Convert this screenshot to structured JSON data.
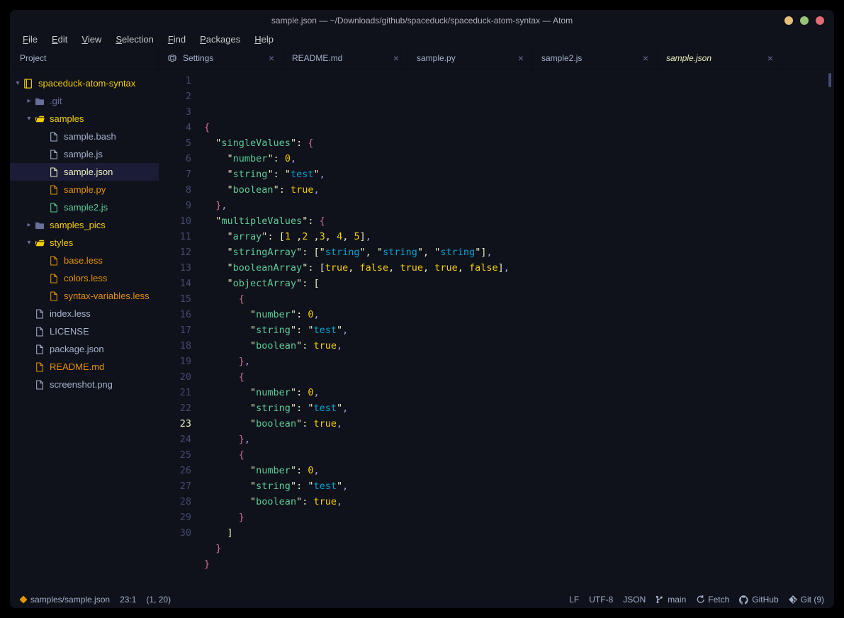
{
  "window": {
    "title": "sample.json — ~/Downloads/github/spaceduck/spaceduck-atom-syntax — Atom"
  },
  "menu": [
    "File",
    "Edit",
    "View",
    "Selection",
    "Find",
    "Packages",
    "Help"
  ],
  "projectTab": "Project",
  "tabs": [
    {
      "label": "Settings",
      "icon": "settings",
      "close": true
    },
    {
      "label": "README.md",
      "icon": "none",
      "close": true
    },
    {
      "label": "sample.py",
      "icon": "none",
      "close": true
    },
    {
      "label": "sample2.js",
      "icon": "none",
      "close": true
    },
    {
      "label": "sample.json",
      "icon": "none",
      "close": true,
      "active": true,
      "italic": true
    }
  ],
  "tree": [
    {
      "depth": 0,
      "chev": "down",
      "icon": "repo",
      "label": "spaceduck-atom-syntax",
      "color": "c-yellow"
    },
    {
      "depth": 1,
      "chev": "right",
      "icon": "folder",
      "label": ".git",
      "color": "c-grey"
    },
    {
      "depth": 1,
      "chev": "down",
      "icon": "folder-open",
      "label": "samples",
      "color": "c-yellow"
    },
    {
      "depth": 2,
      "chev": "",
      "icon": "file",
      "label": "sample.bash",
      "color": "c-muted"
    },
    {
      "depth": 2,
      "chev": "",
      "icon": "file",
      "label": "sample.js",
      "color": "c-muted"
    },
    {
      "depth": 2,
      "chev": "",
      "icon": "file",
      "label": "sample.json",
      "color": "c-white",
      "selected": true
    },
    {
      "depth": 2,
      "chev": "",
      "icon": "file",
      "label": "sample.py",
      "color": "c-orange"
    },
    {
      "depth": 2,
      "chev": "",
      "icon": "file",
      "label": "sample2.js",
      "color": "c-green"
    },
    {
      "depth": 1,
      "chev": "right",
      "icon": "folder",
      "label": "samples_pics",
      "color": "c-yellow"
    },
    {
      "depth": 1,
      "chev": "down",
      "icon": "folder-open",
      "label": "styles",
      "color": "c-yellow"
    },
    {
      "depth": 2,
      "chev": "",
      "icon": "file",
      "label": "base.less",
      "color": "c-orange"
    },
    {
      "depth": 2,
      "chev": "",
      "icon": "file",
      "label": "colors.less",
      "color": "c-orange"
    },
    {
      "depth": 2,
      "chev": "",
      "icon": "file",
      "label": "syntax-variables.less",
      "color": "c-orange"
    },
    {
      "depth": 1,
      "chev": "",
      "icon": "file",
      "label": "index.less",
      "color": "c-muted"
    },
    {
      "depth": 1,
      "chev": "",
      "icon": "file",
      "label": "LICENSE",
      "color": "c-muted"
    },
    {
      "depth": 1,
      "chev": "",
      "icon": "file",
      "label": "package.json",
      "color": "c-muted"
    },
    {
      "depth": 1,
      "chev": "",
      "icon": "file",
      "label": "README.md",
      "color": "c-orange"
    },
    {
      "depth": 1,
      "chev": "",
      "icon": "file",
      "label": "screenshot.png",
      "color": "c-muted"
    }
  ],
  "cursorLine": 23,
  "code": [
    [
      {
        "t": "{",
        "c": "brace"
      }
    ],
    [
      {
        "t": "  ",
        "c": ""
      },
      {
        "t": "\"",
        "c": "punct"
      },
      {
        "t": "singleValues",
        "c": "key"
      },
      {
        "t": "\"",
        "c": "punct"
      },
      {
        "t": ": ",
        "c": "punct"
      },
      {
        "t": "{",
        "c": "brace"
      }
    ],
    [
      {
        "t": "    ",
        "c": ""
      },
      {
        "t": "\"",
        "c": "punct"
      },
      {
        "t": "number",
        "c": "key"
      },
      {
        "t": "\"",
        "c": "punct"
      },
      {
        "t": ": ",
        "c": "punct"
      },
      {
        "t": "0",
        "c": "num"
      },
      {
        "t": ",",
        "c": "comma"
      }
    ],
    [
      {
        "t": "    ",
        "c": ""
      },
      {
        "t": "\"",
        "c": "punct"
      },
      {
        "t": "string",
        "c": "key"
      },
      {
        "t": "\"",
        "c": "punct"
      },
      {
        "t": ": ",
        "c": "punct"
      },
      {
        "t": "\"",
        "c": "punct"
      },
      {
        "t": "test",
        "c": "str"
      },
      {
        "t": "\"",
        "c": "punct"
      },
      {
        "t": ",",
        "c": "comma"
      }
    ],
    [
      {
        "t": "    ",
        "c": ""
      },
      {
        "t": "\"",
        "c": "punct"
      },
      {
        "t": "boolean",
        "c": "key"
      },
      {
        "t": "\"",
        "c": "punct"
      },
      {
        "t": ": ",
        "c": "punct"
      },
      {
        "t": "true",
        "c": "bool"
      },
      {
        "t": ",",
        "c": "comma"
      }
    ],
    [
      {
        "t": "  ",
        "c": ""
      },
      {
        "t": "}",
        "c": "brace"
      },
      {
        "t": ",",
        "c": "comma"
      }
    ],
    [
      {
        "t": "  ",
        "c": ""
      },
      {
        "t": "\"",
        "c": "punct"
      },
      {
        "t": "multipleValues",
        "c": "key"
      },
      {
        "t": "\"",
        "c": "punct"
      },
      {
        "t": ": ",
        "c": "punct"
      },
      {
        "t": "{",
        "c": "brace"
      }
    ],
    [
      {
        "t": "    ",
        "c": ""
      },
      {
        "t": "\"",
        "c": "punct"
      },
      {
        "t": "array",
        "c": "key"
      },
      {
        "t": "\"",
        "c": "punct"
      },
      {
        "t": ": ",
        "c": "punct"
      },
      {
        "t": "[",
        "c": "bracket"
      },
      {
        "t": "1",
        "c": "num"
      },
      {
        "t": " ,",
        "c": "punct"
      },
      {
        "t": "2",
        "c": "num"
      },
      {
        "t": " ,",
        "c": "punct"
      },
      {
        "t": "3",
        "c": "num"
      },
      {
        "t": ", ",
        "c": "punct"
      },
      {
        "t": "4",
        "c": "num"
      },
      {
        "t": ", ",
        "c": "punct"
      },
      {
        "t": "5",
        "c": "num"
      },
      {
        "t": "]",
        "c": "bracket"
      },
      {
        "t": ",",
        "c": "comma"
      }
    ],
    [
      {
        "t": "    ",
        "c": ""
      },
      {
        "t": "\"",
        "c": "punct"
      },
      {
        "t": "stringArray",
        "c": "key"
      },
      {
        "t": "\"",
        "c": "punct"
      },
      {
        "t": ": ",
        "c": "punct"
      },
      {
        "t": "[",
        "c": "bracket"
      },
      {
        "t": "\"",
        "c": "punct"
      },
      {
        "t": "string",
        "c": "str"
      },
      {
        "t": "\"",
        "c": "punct"
      },
      {
        "t": ", ",
        "c": "punct"
      },
      {
        "t": "\"",
        "c": "punct"
      },
      {
        "t": "string",
        "c": "str"
      },
      {
        "t": "\"",
        "c": "punct"
      },
      {
        "t": ", ",
        "c": "punct"
      },
      {
        "t": "\"",
        "c": "punct"
      },
      {
        "t": "string",
        "c": "str"
      },
      {
        "t": "\"",
        "c": "punct"
      },
      {
        "t": "]",
        "c": "bracket"
      },
      {
        "t": ",",
        "c": "comma"
      }
    ],
    [
      {
        "t": "    ",
        "c": ""
      },
      {
        "t": "\"",
        "c": "punct"
      },
      {
        "t": "booleanArray",
        "c": "key"
      },
      {
        "t": "\"",
        "c": "punct"
      },
      {
        "t": ": ",
        "c": "punct"
      },
      {
        "t": "[",
        "c": "bracket"
      },
      {
        "t": "true",
        "c": "bool"
      },
      {
        "t": ", ",
        "c": "punct"
      },
      {
        "t": "false",
        "c": "bool"
      },
      {
        "t": ", ",
        "c": "punct"
      },
      {
        "t": "true",
        "c": "bool"
      },
      {
        "t": ", ",
        "c": "punct"
      },
      {
        "t": "true",
        "c": "bool"
      },
      {
        "t": ", ",
        "c": "punct"
      },
      {
        "t": "false",
        "c": "bool"
      },
      {
        "t": "]",
        "c": "bracket"
      },
      {
        "t": ",",
        "c": "comma"
      }
    ],
    [
      {
        "t": "    ",
        "c": ""
      },
      {
        "t": "\"",
        "c": "punct"
      },
      {
        "t": "objectArray",
        "c": "key"
      },
      {
        "t": "\"",
        "c": "punct"
      },
      {
        "t": ": ",
        "c": "punct"
      },
      {
        "t": "[",
        "c": "bracket"
      }
    ],
    [
      {
        "t": "      ",
        "c": ""
      },
      {
        "t": "{",
        "c": "brace"
      }
    ],
    [
      {
        "t": "        ",
        "c": ""
      },
      {
        "t": "\"",
        "c": "punct"
      },
      {
        "t": "number",
        "c": "key"
      },
      {
        "t": "\"",
        "c": "punct"
      },
      {
        "t": ": ",
        "c": "punct"
      },
      {
        "t": "0",
        "c": "num"
      },
      {
        "t": ",",
        "c": "comma"
      }
    ],
    [
      {
        "t": "        ",
        "c": ""
      },
      {
        "t": "\"",
        "c": "punct"
      },
      {
        "t": "string",
        "c": "key"
      },
      {
        "t": "\"",
        "c": "punct"
      },
      {
        "t": ": ",
        "c": "punct"
      },
      {
        "t": "\"",
        "c": "punct"
      },
      {
        "t": "test",
        "c": "str"
      },
      {
        "t": "\"",
        "c": "punct"
      },
      {
        "t": ",",
        "c": "comma"
      }
    ],
    [
      {
        "t": "        ",
        "c": ""
      },
      {
        "t": "\"",
        "c": "punct"
      },
      {
        "t": "boolean",
        "c": "key"
      },
      {
        "t": "\"",
        "c": "punct"
      },
      {
        "t": ": ",
        "c": "punct"
      },
      {
        "t": "true",
        "c": "bool"
      },
      {
        "t": ",",
        "c": "comma"
      }
    ],
    [
      {
        "t": "      ",
        "c": ""
      },
      {
        "t": "}",
        "c": "brace"
      },
      {
        "t": ",",
        "c": "comma"
      }
    ],
    [
      {
        "t": "      ",
        "c": ""
      },
      {
        "t": "{",
        "c": "brace"
      }
    ],
    [
      {
        "t": "        ",
        "c": ""
      },
      {
        "t": "\"",
        "c": "punct"
      },
      {
        "t": "number",
        "c": "key"
      },
      {
        "t": "\"",
        "c": "punct"
      },
      {
        "t": ": ",
        "c": "punct"
      },
      {
        "t": "0",
        "c": "num"
      },
      {
        "t": ",",
        "c": "comma"
      }
    ],
    [
      {
        "t": "        ",
        "c": ""
      },
      {
        "t": "\"",
        "c": "punct"
      },
      {
        "t": "string",
        "c": "key"
      },
      {
        "t": "\"",
        "c": "punct"
      },
      {
        "t": ": ",
        "c": "punct"
      },
      {
        "t": "\"",
        "c": "punct"
      },
      {
        "t": "test",
        "c": "str"
      },
      {
        "t": "\"",
        "c": "punct"
      },
      {
        "t": ",",
        "c": "comma"
      }
    ],
    [
      {
        "t": "        ",
        "c": ""
      },
      {
        "t": "\"",
        "c": "punct"
      },
      {
        "t": "boolean",
        "c": "key"
      },
      {
        "t": "\"",
        "c": "punct"
      },
      {
        "t": ": ",
        "c": "punct"
      },
      {
        "t": "true",
        "c": "bool"
      },
      {
        "t": ",",
        "c": "comma"
      }
    ],
    [
      {
        "t": "      ",
        "c": ""
      },
      {
        "t": "}",
        "c": "brace"
      },
      {
        "t": ",",
        "c": "comma"
      }
    ],
    [
      {
        "t": "      ",
        "c": ""
      },
      {
        "t": "{",
        "c": "brace"
      }
    ],
    [
      {
        "t": "        ",
        "c": ""
      },
      {
        "t": "\"",
        "c": "punct"
      },
      {
        "t": "number",
        "c": "key"
      },
      {
        "t": "\"",
        "c": "punct"
      },
      {
        "t": ": ",
        "c": "punct"
      },
      {
        "t": "0",
        "c": "num"
      },
      {
        "t": ",",
        "c": "comma"
      }
    ],
    [
      {
        "t": "        ",
        "c": ""
      },
      {
        "t": "\"",
        "c": "punct"
      },
      {
        "t": "string",
        "c": "key"
      },
      {
        "t": "\"",
        "c": "punct"
      },
      {
        "t": ": ",
        "c": "punct"
      },
      {
        "t": "\"",
        "c": "punct"
      },
      {
        "t": "test",
        "c": "str"
      },
      {
        "t": "\"",
        "c": "punct"
      },
      {
        "t": ",",
        "c": "comma"
      }
    ],
    [
      {
        "t": "        ",
        "c": ""
      },
      {
        "t": "\"",
        "c": "punct"
      },
      {
        "t": "boolean",
        "c": "key"
      },
      {
        "t": "\"",
        "c": "punct"
      },
      {
        "t": ": ",
        "c": "punct"
      },
      {
        "t": "true",
        "c": "bool"
      },
      {
        "t": ",",
        "c": "comma"
      }
    ],
    [
      {
        "t": "      ",
        "c": ""
      },
      {
        "t": "}",
        "c": "brace"
      }
    ],
    [
      {
        "t": "    ",
        "c": ""
      },
      {
        "t": "]",
        "c": "bracket"
      }
    ],
    [
      {
        "t": "  ",
        "c": ""
      },
      {
        "t": "}",
        "c": "brace"
      }
    ],
    [
      {
        "t": "}",
        "c": "brace"
      }
    ],
    []
  ],
  "status": {
    "path": "samples/sample.json",
    "cursor": "23:1",
    "selection": "(1, 20)",
    "lineEnding": "LF",
    "encoding": "UTF-8",
    "grammar": "JSON",
    "branch": "main",
    "fetch": "Fetch",
    "github": "GitHub",
    "git": "Git (9)"
  }
}
